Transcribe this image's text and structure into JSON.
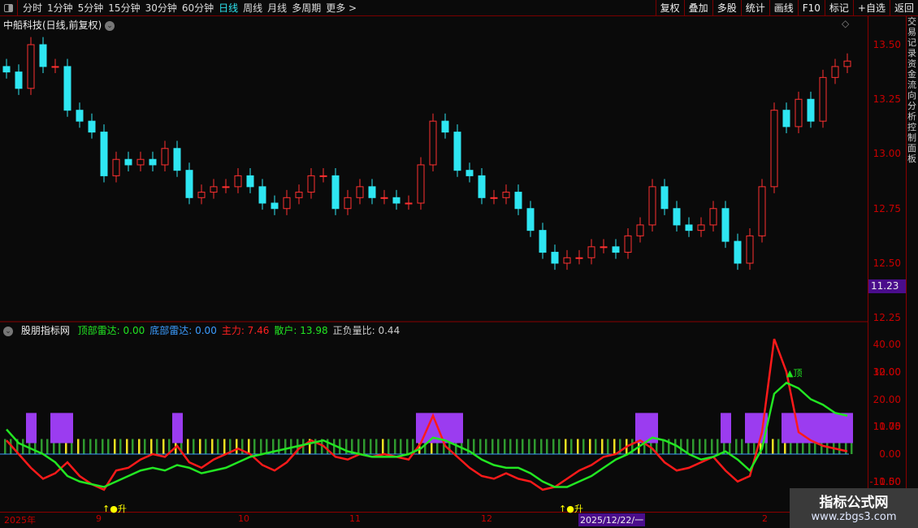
{
  "toolbar": {
    "periods": [
      "分时",
      "1分钟",
      "5分钟",
      "15分钟",
      "30分钟",
      "60分钟",
      "日线",
      "周线",
      "月线",
      "多周期",
      "更多 >"
    ],
    "active": "日线",
    "buttons": [
      "复权",
      "叠加",
      "多股",
      "统计",
      "画线",
      "F10",
      "标记",
      "+自选",
      "返回"
    ]
  },
  "stock_title": "中船科技(日线,前复权)",
  "price_axis": [
    "13.50",
    "13.25",
    "13.00",
    "12.75",
    "12.50",
    "12.25",
    "12.00",
    "11.75",
    "11.50"
  ],
  "current_price": "11.23",
  "indicator": {
    "name": "股朋指标网",
    "items": [
      {
        "label": "顶部雷达: 0.00",
        "color": "#22e622"
      },
      {
        "label": "底部雷达: 0.00",
        "color": "#3b9cff"
      },
      {
        "label": "主力: 7.46",
        "color": "#ff2020"
      },
      {
        "label": "散户: 13.98",
        "color": "#22e622"
      },
      {
        "label": "正负量比: 0.44",
        "color": "#cccccc"
      }
    ],
    "axis": [
      "40.00",
      "30.00",
      "20.00",
      "10.00",
      "0.00",
      "-10.00"
    ],
    "top_label": "▲顶",
    "rise_label": "↑●升"
  },
  "time_axis": {
    "labels": [
      "2025年",
      "9",
      "10",
      "11",
      "12",
      "2"
    ],
    "cursor_date": "2025/12/22/一"
  },
  "watermark": {
    "title": "指标公式网",
    "url": "www.zbgs3.com"
  },
  "side_text": "交易记录资金流向分析控制面板",
  "chart_data": {
    "type": "candlestick",
    "closes": [
      13.25,
      13.1,
      13.5,
      13.3,
      13.3,
      12.9,
      12.8,
      12.7,
      12.3,
      12.45,
      12.4,
      12.45,
      12.4,
      12.55,
      12.35,
      12.1,
      12.15,
      12.2,
      12.2,
      12.3,
      12.2,
      12.05,
      12.0,
      12.1,
      12.15,
      12.3,
      12.3,
      12.0,
      12.1,
      12.2,
      12.1,
      12.1,
      12.05,
      12.05,
      12.4,
      12.8,
      12.7,
      12.35,
      12.3,
      12.1,
      12.1,
      12.15,
      12.0,
      11.8,
      11.6,
      11.5,
      11.55,
      11.55,
      11.65,
      11.65,
      11.6,
      11.75,
      11.85,
      12.2,
      12.0,
      11.85,
      11.8,
      11.85,
      12.0,
      11.7,
      11.5,
      11.75,
      12.2,
      12.9,
      12.75,
      13.0,
      12.8,
      13.2,
      13.3,
      13.35
    ],
    "main": [
      5,
      0,
      -5,
      -9,
      -7,
      -3,
      -8,
      -11,
      -13,
      -6,
      -5,
      -2,
      0,
      -1,
      3,
      -3,
      -5,
      -2,
      0,
      2,
      0,
      -4,
      -6,
      -3,
      2,
      5,
      3,
      -1,
      -2,
      0,
      -1,
      0,
      -1,
      -2,
      4,
      14,
      3,
      -1,
      -5,
      -8,
      -9,
      -7,
      -9,
      -10,
      -13,
      -12,
      -9,
      -6,
      -4,
      -1,
      0,
      3,
      5,
      2,
      -3,
      -6,
      -5,
      -3,
      -1,
      -6,
      -10,
      -8,
      8,
      42,
      30,
      8,
      5,
      3,
      2,
      1
    ],
    "retail": [
      9,
      4,
      2,
      0,
      -3,
      -8,
      -10,
      -11,
      -12,
      -10,
      -8,
      -6,
      -5,
      -6,
      -4,
      -5,
      -7,
      -6,
      -5,
      -3,
      -1,
      0,
      1,
      2,
      3,
      4,
      5,
      3,
      1,
      0,
      -1,
      -1,
      -1,
      0,
      2,
      6,
      5,
      3,
      1,
      -2,
      -4,
      -5,
      -5,
      -7,
      -10,
      -12,
      -12,
      -10,
      -8,
      -5,
      -2,
      0,
      3,
      6,
      5,
      3,
      0,
      -2,
      -1,
      1,
      -2,
      -6,
      2,
      22,
      26,
      24,
      20,
      18,
      15,
      14
    ],
    "purple_blocks": [
      [
        2,
        2
      ],
      [
        4,
        5
      ],
      [
        14,
        14
      ],
      [
        34,
        37
      ],
      [
        52,
        53
      ],
      [
        59,
        59
      ],
      [
        61,
        62
      ],
      [
        64,
        69
      ]
    ],
    "ylim_price": [
      11.1,
      13.7
    ],
    "ylim_indicator": [
      -13,
      45
    ]
  }
}
